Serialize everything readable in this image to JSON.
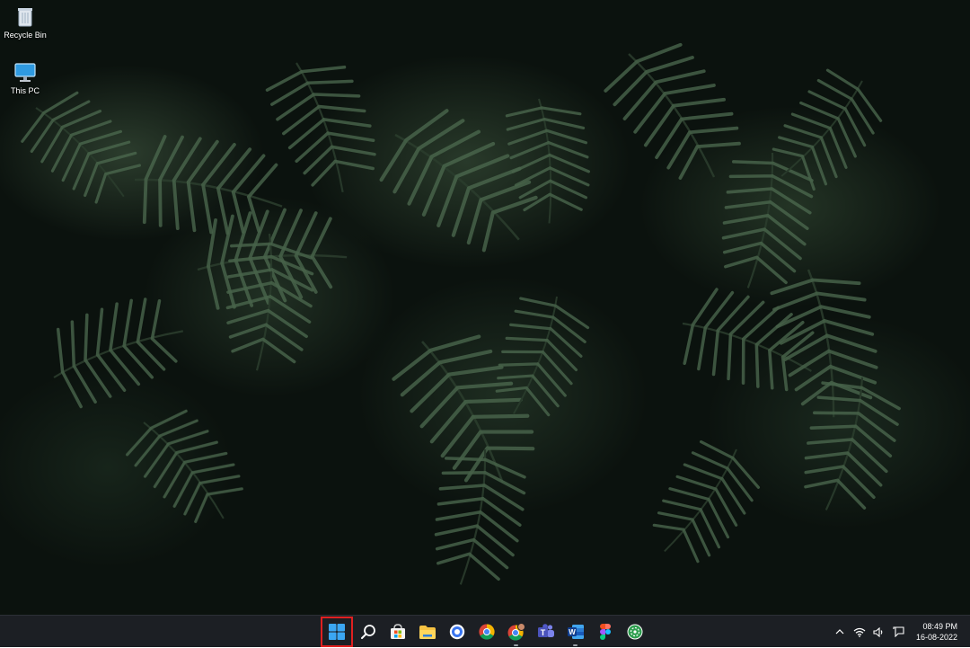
{
  "desktop": {
    "icons": [
      {
        "label": "Recycle Bin",
        "icon": "recycle-bin-icon"
      },
      {
        "label": "This PC",
        "icon": "this-pc-icon"
      }
    ]
  },
  "taskbar": {
    "apps": [
      {
        "name": "Start",
        "icon": "windows-logo-icon",
        "highlighted": true
      },
      {
        "name": "Search",
        "icon": "search-icon"
      },
      {
        "name": "Microsoft Store",
        "icon": "store-icon"
      },
      {
        "name": "File Explorer",
        "icon": "folder-icon"
      },
      {
        "name": "Signal",
        "icon": "signal-icon"
      },
      {
        "name": "Google Chrome",
        "icon": "chrome-icon"
      },
      {
        "name": "Google Chrome (profile)",
        "icon": "chrome-profile-icon",
        "running": true
      },
      {
        "name": "Microsoft Teams",
        "icon": "teams-icon"
      },
      {
        "name": "Microsoft Word",
        "icon": "word-icon",
        "running": true
      },
      {
        "name": "Figma",
        "icon": "figma-icon"
      },
      {
        "name": "Cinnamon app",
        "icon": "green-app-icon"
      }
    ],
    "highlight_color": "#e02020",
    "tray": {
      "icons": [
        "chevron-up-icon",
        "wifi-icon",
        "speaker-icon",
        "notification-icon"
      ],
      "time": "08:49 PM",
      "date": "16-08-2022"
    }
  }
}
